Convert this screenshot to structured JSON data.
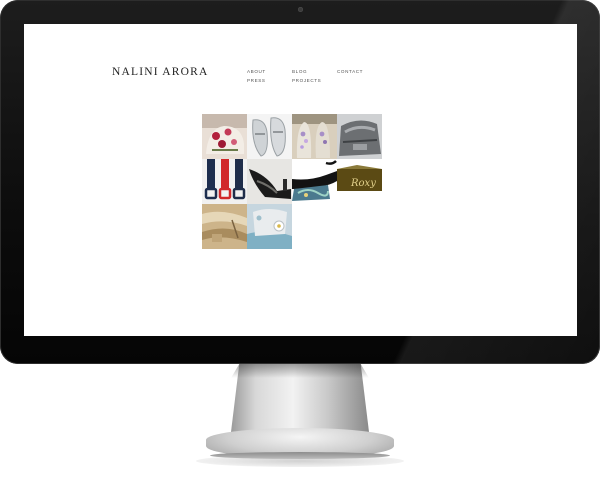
{
  "site": {
    "logo": "NALINI ARORA"
  },
  "nav": {
    "items": [
      {
        "label": "ABOUT"
      },
      {
        "label": "BLOG"
      },
      {
        "label": "CONTACT"
      },
      {
        "label": "PRESS"
      },
      {
        "label": "PROJECTS"
      }
    ]
  },
  "gallery": {
    "tiles": [
      {
        "subject": "floral-shoe-photo"
      },
      {
        "subject": "silver-flats-photo"
      },
      {
        "subject": "embellished-sandals-photo"
      },
      {
        "subject": "silver-bag-photo"
      },
      {
        "subject": "colored-belts-photo"
      },
      {
        "subject": "black-heel-photo"
      },
      {
        "subject": "painted-wedge-photo"
      },
      {
        "subject": "olive-logo-photo"
      },
      {
        "subject": "beige-fabric-photo"
      },
      {
        "subject": "flower-clutch-photo"
      }
    ],
    "logo_text": "Roxy"
  },
  "colors": {
    "bezel": "#0c0c0c",
    "screen": "#ffffff",
    "logo_text": "#222222",
    "nav_text": "#555555",
    "stand": "#d8d8d8"
  }
}
